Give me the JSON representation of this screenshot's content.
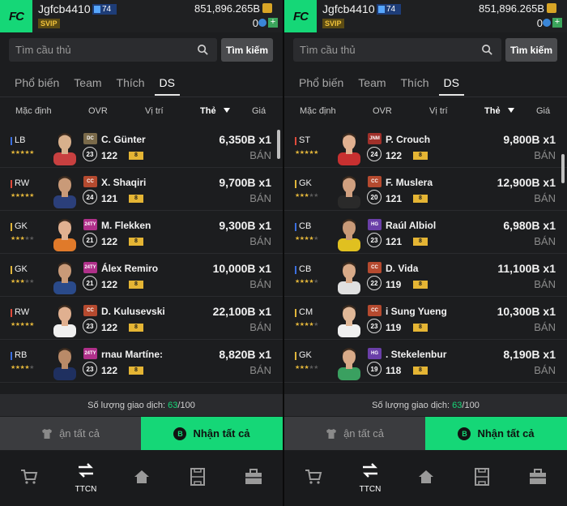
{
  "panels": [
    {
      "header": {
        "logo_text": "FC",
        "username": "Jgfcb4410",
        "level": "74",
        "vip": "SVIP",
        "coins": "851,896.265B",
        "fc_points": "0"
      },
      "search": {
        "placeholder": "Tìm cầu thủ",
        "button": "Tìm kiếm"
      },
      "tabs": [
        {
          "label": "Phổ biến"
        },
        {
          "label": "Team"
        },
        {
          "label": "Thích"
        },
        {
          "label": "DS",
          "active": true
        }
      ],
      "columns": {
        "default": "Mặc định",
        "ovr": "OVR",
        "position": "Vị trí",
        "card": "Thẻ",
        "price": "Giá"
      },
      "rows": [
        {
          "pos": "LB",
          "pos_color": "#3b6fe0",
          "stars": 5,
          "card": "DC",
          "card_color": "#7a6a4a",
          "level": "23",
          "name": "C. Günter",
          "ovr": "122",
          "plus": "8",
          "price": "6,350B x1",
          "sell": "BÁN",
          "kit": "#c84040",
          "skin": "#d8b08c"
        },
        {
          "pos": "RW",
          "pos_color": "#e04a3b",
          "stars": 5,
          "card": "CC",
          "card_color": "#b54a2f",
          "level": "24",
          "name": "X. Shaqiri",
          "ovr": "121",
          "plus": "8",
          "price": "9,700B x1",
          "sell": "BÁN",
          "kit": "#2b3f7a",
          "skin": "#c99a78"
        },
        {
          "pos": "GK",
          "pos_color": "#e0b53b",
          "stars": 3,
          "card": "24TY",
          "card_color": "#b0308a",
          "level": "21",
          "name": "M. Flekken",
          "ovr": "122",
          "plus": "8",
          "price": "9,300B x1",
          "sell": "BÁN",
          "kit": "#e07a2a",
          "skin": "#e0b090"
        },
        {
          "pos": "GK",
          "pos_color": "#e0b53b",
          "stars": 3,
          "card": "24TY",
          "card_color": "#b0308a",
          "level": "21",
          "name": "Álex Remiro",
          "ovr": "122",
          "plus": "8",
          "price": "10,000B x1",
          "sell": "BÁN",
          "kit": "#2a4a8a",
          "skin": "#c99a78"
        },
        {
          "pos": "RW",
          "pos_color": "#e04a3b",
          "stars": 5,
          "card": "CC",
          "card_color": "#b54a2f",
          "level": "23",
          "name": "D. Kulusevski",
          "ovr": "122",
          "plus": "8",
          "price": "22,100B x1",
          "sell": "BÁN",
          "kit": "#f0f0f0",
          "skin": "#e0b090"
        },
        {
          "pos": "RB",
          "pos_color": "#3b6fe0",
          "stars": 4,
          "card": "24TY",
          "card_color": "#b0308a",
          "level": "23",
          "name": "rnau Martíne:",
          "ovr": "122",
          "plus": "8",
          "price": "8,820B x1",
          "sell": "BÁN",
          "kit": "#1f3060",
          "skin": "#b98a68"
        }
      ],
      "trade": {
        "label": "Số lượng giao dịch:",
        "current": "63",
        "max": "/100"
      },
      "buttons": {
        "sell_all": "ận tất cả",
        "claim_all": "Nhận tất cả",
        "claim_icon": "B"
      },
      "nav": [
        {
          "icon": "cart-icon",
          "label": ""
        },
        {
          "icon": "transfer-icon",
          "label": "TTCN"
        },
        {
          "icon": "home-icon",
          "label": ""
        },
        {
          "icon": "pitch-icon",
          "label": ""
        },
        {
          "icon": "briefcase-icon",
          "label": ""
        }
      ]
    },
    {
      "header": {
        "logo_text": "FC",
        "username": "Jgfcb4410",
        "level": "74",
        "vip": "SVIP",
        "coins": "851,896.265B",
        "fc_points": "0"
      },
      "search": {
        "placeholder": "Tìm cầu thủ",
        "button": "Tìm kiếm"
      },
      "tabs": [
        {
          "label": "Phổ biến"
        },
        {
          "label": "Team"
        },
        {
          "label": "Thích"
        },
        {
          "label": "DS",
          "active": true
        }
      ],
      "columns": {
        "default": "Mặc định",
        "ovr": "OVR",
        "position": "Vị trí",
        "card": "Thẻ",
        "price": "Giá"
      },
      "rows": [
        {
          "pos": "ST",
          "pos_color": "#e04a3b",
          "stars": 5,
          "card": "JNM",
          "card_color": "#a0302a",
          "level": "24",
          "name": "P. Crouch",
          "ovr": "122",
          "plus": "8",
          "price": "9,800B x1",
          "sell": "BÁN",
          "kit": "#c83030",
          "skin": "#e0b090"
        },
        {
          "pos": "GK",
          "pos_color": "#e0b53b",
          "stars": 3,
          "card": "CC",
          "card_color": "#b54a2f",
          "level": "20",
          "name": "F. Muslera",
          "ovr": "121",
          "plus": "8",
          "price": "12,900B x1",
          "sell": "BÁN",
          "kit": "#2a2a2a",
          "skin": "#d0a080"
        },
        {
          "pos": "CB",
          "pos_color": "#3b6fe0",
          "stars": 4,
          "card": "HG",
          "card_color": "#6a3fa8",
          "level": "23",
          "name": "Raúl Albiol",
          "ovr": "121",
          "plus": "8",
          "price": "6,980B x1",
          "sell": "BÁN",
          "kit": "#e0c020",
          "skin": "#c99a78"
        },
        {
          "pos": "CB",
          "pos_color": "#3b6fe0",
          "stars": 4,
          "card": "CC",
          "card_color": "#b54a2f",
          "level": "22",
          "name": "D. Vida",
          "ovr": "119",
          "plus": "8",
          "price": "11,100B x1",
          "sell": "BÁN",
          "kit": "#e0e0e0",
          "skin": "#d8aa88"
        },
        {
          "pos": "CM",
          "pos_color": "#e0b53b",
          "stars": 4,
          "card": "CC",
          "card_color": "#b54a2f",
          "level": "23",
          "name": "i Sung Yueng",
          "ovr": "119",
          "plus": "8",
          "price": "10,300B x1",
          "sell": "BÁN",
          "kit": "#f0f0f0",
          "skin": "#e0b898"
        },
        {
          "pos": "GK",
          "pos_color": "#e0b53b",
          "stars": 3,
          "card": "HG",
          "card_color": "#6a3fa8",
          "level": "19",
          "name": ". Stekelenbur",
          "ovr": "118",
          "plus": "8",
          "price": "8,190B x1",
          "sell": "BÁN",
          "kit": "#3aa060",
          "skin": "#d8aa88"
        }
      ],
      "trade": {
        "label": "Số lượng giao dịch:",
        "current": "63",
        "max": "/100"
      },
      "buttons": {
        "sell_all": "ận tất cả",
        "claim_all": "Nhận tất cả",
        "claim_icon": "B"
      },
      "nav": [
        {
          "icon": "cart-icon",
          "label": ""
        },
        {
          "icon": "transfer-icon",
          "label": "TTCN"
        },
        {
          "icon": "home-icon",
          "label": ""
        },
        {
          "icon": "pitch-icon",
          "label": ""
        },
        {
          "icon": "briefcase-icon",
          "label": ""
        }
      ]
    }
  ]
}
